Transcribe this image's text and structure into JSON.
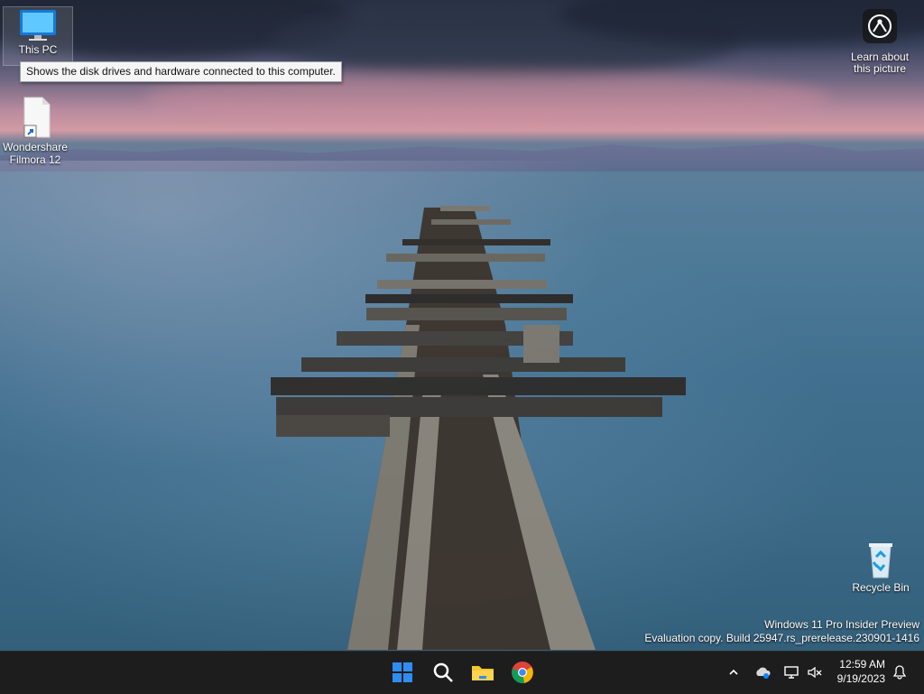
{
  "desktop": {
    "icons": [
      {
        "id": "this-pc",
        "label": "This PC"
      },
      {
        "id": "wondershare-filmora",
        "label": "Wondershare Filmora 12"
      },
      {
        "id": "recycle-bin",
        "label": "Recycle Bin"
      }
    ],
    "tooltip": "Shows the disk drives and hardware connected to this computer.",
    "learn_label": "Learn about this picture",
    "watermark": {
      "line1": "Windows 11 Pro Insider Preview",
      "line2": "Evaluation copy. Build 25947.rs_prerelease.230901-1416"
    }
  },
  "taskbar": {
    "apps": [
      {
        "icon": "windows-start-icon"
      },
      {
        "icon": "search-icon"
      },
      {
        "icon": "file-explorer-icon"
      },
      {
        "icon": "chrome-icon"
      }
    ],
    "tray": [
      {
        "icon": "chevron-up-icon"
      },
      {
        "icon": "onedrive-icon"
      },
      {
        "icon": "network-icon"
      },
      {
        "icon": "volume-muted-icon"
      },
      {
        "icon": "notification-bell-icon"
      }
    ],
    "time": "12:59 AM",
    "date": "9/19/2023"
  },
  "colors": {
    "taskbar": "#1d1d1d",
    "start_blue": "#2f8df1",
    "chrome_red": "#db4437",
    "chrome_yellow": "#f4b400",
    "chrome_green": "#0f9d58"
  }
}
